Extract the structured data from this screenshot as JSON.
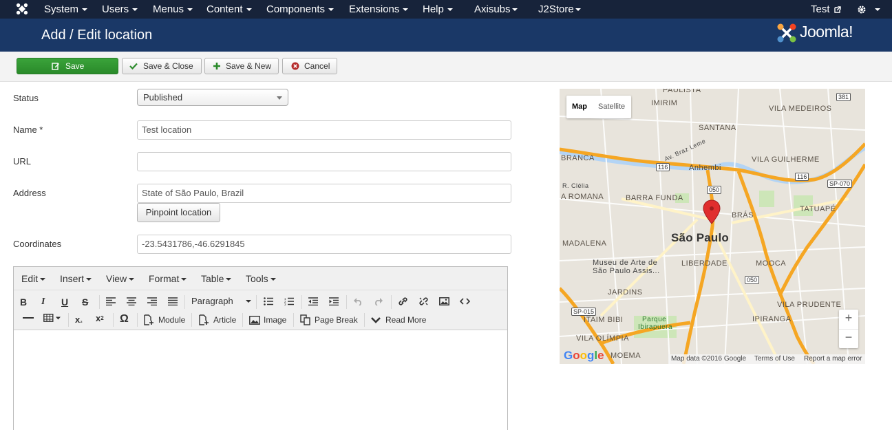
{
  "navbar": {
    "items": [
      "System",
      "Users",
      "Menus",
      "Content",
      "Components",
      "Extensions",
      "Help",
      "Axisubs",
      "J2Store"
    ],
    "user": "Test"
  },
  "header": {
    "title": "Add / Edit location",
    "brand": "Joomla!"
  },
  "toolbar": {
    "save": "Save",
    "save_close": "Save & Close",
    "save_new": "Save & New",
    "cancel": "Cancel"
  },
  "form": {
    "status_label": "Status",
    "status_value": "Published",
    "name_label": "Name *",
    "name_value": "Test location",
    "url_label": "URL",
    "url_value": "",
    "address_label": "Address",
    "address_value": "State of São Paulo, Brazil",
    "pinpoint_label": "Pinpoint location",
    "coordinates_label": "Coordinates",
    "coordinates_value": "-23.5431786,-46.6291845"
  },
  "editor": {
    "menus": [
      "Edit",
      "Insert",
      "View",
      "Format",
      "Table",
      "Tools"
    ],
    "paragraph": "Paragraph",
    "buttons": {
      "module": "Module",
      "article": "Article",
      "image": "Image",
      "page_break": "Page Break",
      "read_more": "Read More"
    }
  },
  "map": {
    "type_map": "Map",
    "type_satellite": "Satellite",
    "zoom_in": "+",
    "zoom_out": "−",
    "google": "Google",
    "attribution": "Map data ©2016 Google",
    "terms": "Terms of Use",
    "report": "Report a map error",
    "labels": {
      "city": "São Paulo",
      "imirim": "IMIRIM",
      "vila_medeiros": "VILA MEDEIROS",
      "santana": "SANTANA",
      "branca": "BRANCA",
      "anhembi": "Anhembi",
      "vila_guilherme": "VILA GUILHERME",
      "barra_funda": "BARRA FUNDA",
      "a_romana": "A ROMANA",
      "bras": "BRÁS",
      "tatuape": "TATUAPÉ",
      "madalena": "MADALENA",
      "liberdade": "LIBERDADE",
      "mooca": "MOOCA",
      "museu": "Museu de Arte de",
      "museu2": "São Paulo Assis...",
      "jardins": "JARDINS",
      "vila_prudente": "VILA PRUDENTE",
      "itaim_bibi": "ITAIM BIBI",
      "parque": "Parque",
      "ibirapuera": "Ibirapuera",
      "ipiranga": "IPIRANGA",
      "vila_olimpia": "VILA OLÍMPIA",
      "moema": "MOEMA",
      "paulista": "PAULISTA",
      "r_clelia": "R. Clélia",
      "av_braz_leme": "Av. Braz Leme",
      "shield_381": "381",
      "shield_116a": "116",
      "shield_050a": "050",
      "shield_116b": "116",
      "shield_sp070": "SP-070",
      "shield_050b": "050",
      "shield_sp015": "SP-015"
    }
  },
  "colors": {
    "navbar": "#17233a",
    "header": "#1a3867",
    "save": "#2e8f2e",
    "map_bg": "#e8e4dc",
    "highway": "#f5a623"
  }
}
